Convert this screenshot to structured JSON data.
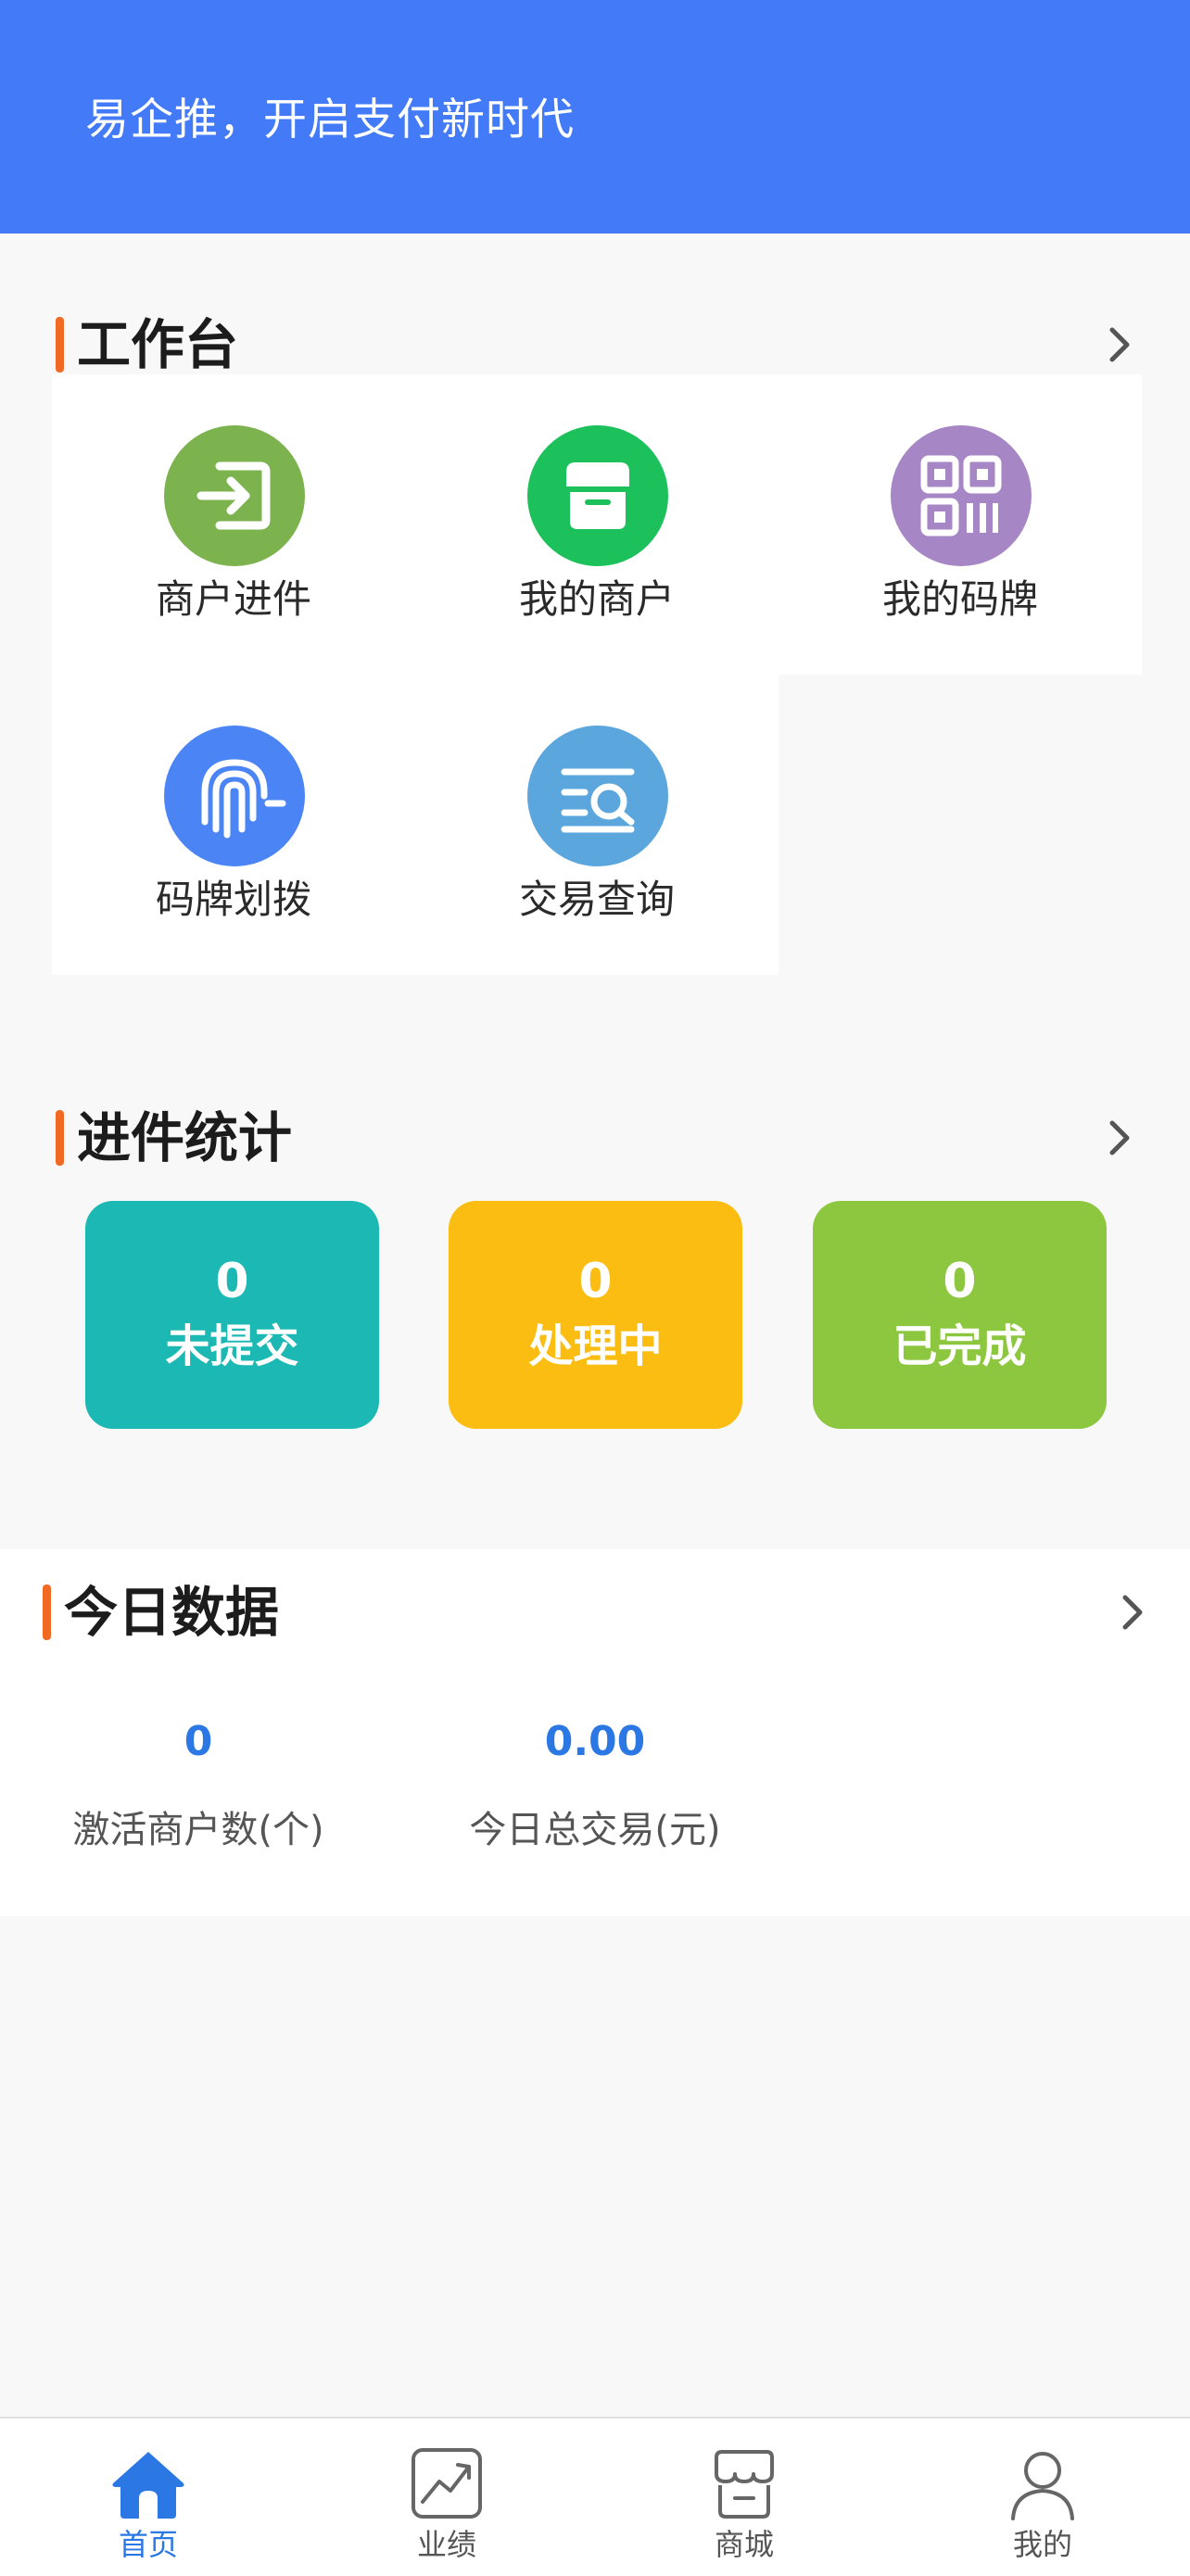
{
  "header": {
    "title": "易企推，开启支付新时代"
  },
  "workbench": {
    "title": "工作台",
    "items": [
      {
        "label": "商户进件",
        "icon": "login-arrow-icon",
        "color": "#7cb34f"
      },
      {
        "label": "我的商户",
        "icon": "store-icon",
        "color": "#1dc15b"
      },
      {
        "label": "我的码牌",
        "icon": "qr-code-icon",
        "color": "#a686c4"
      },
      {
        "label": "码牌划拨",
        "icon": "fingerprint-icon",
        "color": "#4a84f5"
      },
      {
        "label": "交易查询",
        "icon": "list-search-icon",
        "color": "#5aa6dd"
      }
    ]
  },
  "stats": {
    "title": "进件统计",
    "cards": [
      {
        "value": "0",
        "label": "未提交",
        "color": "#1cb8b3"
      },
      {
        "value": "0",
        "label": "处理中",
        "color": "#fbbd12"
      },
      {
        "value": "0",
        "label": "已完成",
        "color": "#8dc63f"
      }
    ]
  },
  "today": {
    "title": "今日数据",
    "items": [
      {
        "value": "0",
        "label": "激活商户数(个)"
      },
      {
        "value": "0.00",
        "label": "今日总交易(元)"
      }
    ]
  },
  "tabbar": {
    "tabs": [
      {
        "label": "首页",
        "icon": "home-icon",
        "active": true
      },
      {
        "label": "业绩",
        "icon": "trend-chart-icon",
        "active": false
      },
      {
        "label": "商城",
        "icon": "shop-icon",
        "active": false
      },
      {
        "label": "我的",
        "icon": "user-icon",
        "active": false
      }
    ]
  },
  "colors": {
    "primary": "#427af8",
    "accent_bar": "#f06a24",
    "value_blue": "#2b78e4"
  }
}
